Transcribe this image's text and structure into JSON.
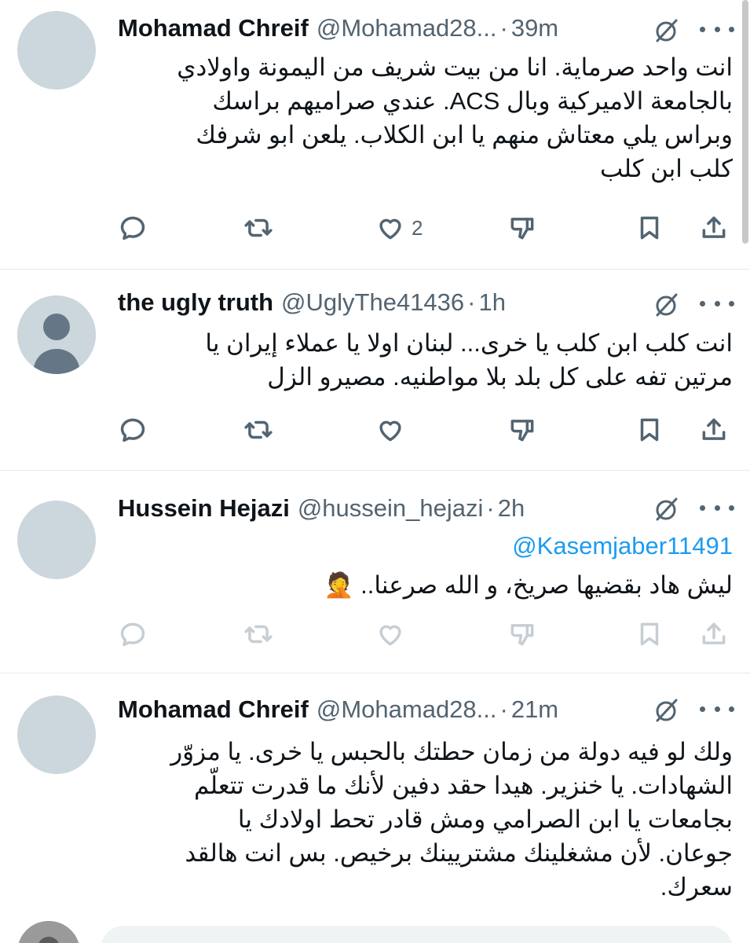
{
  "tweets": [
    {
      "name": "Mohamad Chreif",
      "handle": "@Mohamad28...",
      "dot": "·",
      "time": "39m",
      "lines": [
        "انت واحد صرماية. انا من بيت شريف من اليمونة واولادي",
        "بالجامعة الاميركية وبال ACS. عندي صراميهم براسك",
        "وبراس يلي معتاش منهم يا ابن الكلاب. يلعن ابو شرفك",
        "كلب ابن كلب"
      ],
      "likes": "2",
      "avatar": "blank"
    },
    {
      "name": "the ugly truth",
      "handle": "@UglyThe41436",
      "dot": "·",
      "time": "1h",
      "lines": [
        "انت كلب ابن كلب يا خرى... لبنان اولا يا عملاء إيران يا",
        "مرتين تفه على كل بلد بلا مواطنيه. مصيرو الزل"
      ],
      "likes": "",
      "avatar": "default-person"
    },
    {
      "name": "Hussein Hejazi",
      "handle": "@hussein_hejazi",
      "dot": "·",
      "time": "2h",
      "mention": "@Kasemjaber11491",
      "lines": [
        "ليش هاد بقضيها صريخ، و الله صرعنا.. 🤦"
      ],
      "likes": "",
      "avatar": "blank"
    },
    {
      "name": "Mohamad Chreif",
      "handle": "@Mohamad28...",
      "dot": "·",
      "time": "21m",
      "lines": [
        "ولك لو فيه دولة من زمان حطتك بالحبس يا خرى. يا مزوّر",
        "الشهادات. يا خنزير. هيدا حقد دفين لأنك ما قدرت تتعلّم",
        "بجامعات يا ابن الصرامي ومش قادر تحط اولادك يا",
        "جوعان. لأن مشغلينك مشتريينك برخيص. بس انت هالقد",
        "سعرك."
      ],
      "likes": "",
      "avatar": "blank"
    }
  ],
  "icons": [
    "reply-icon",
    "retweet-icon",
    "like-icon",
    "dislike-icon",
    "bookmark-icon",
    "share-icon",
    "grok-icon",
    "more-icon"
  ],
  "colors": {
    "link": "#1d9bf0",
    "secondary": "#536471",
    "avatar": "#ccd6dd",
    "divider": "#e6e9ec"
  }
}
